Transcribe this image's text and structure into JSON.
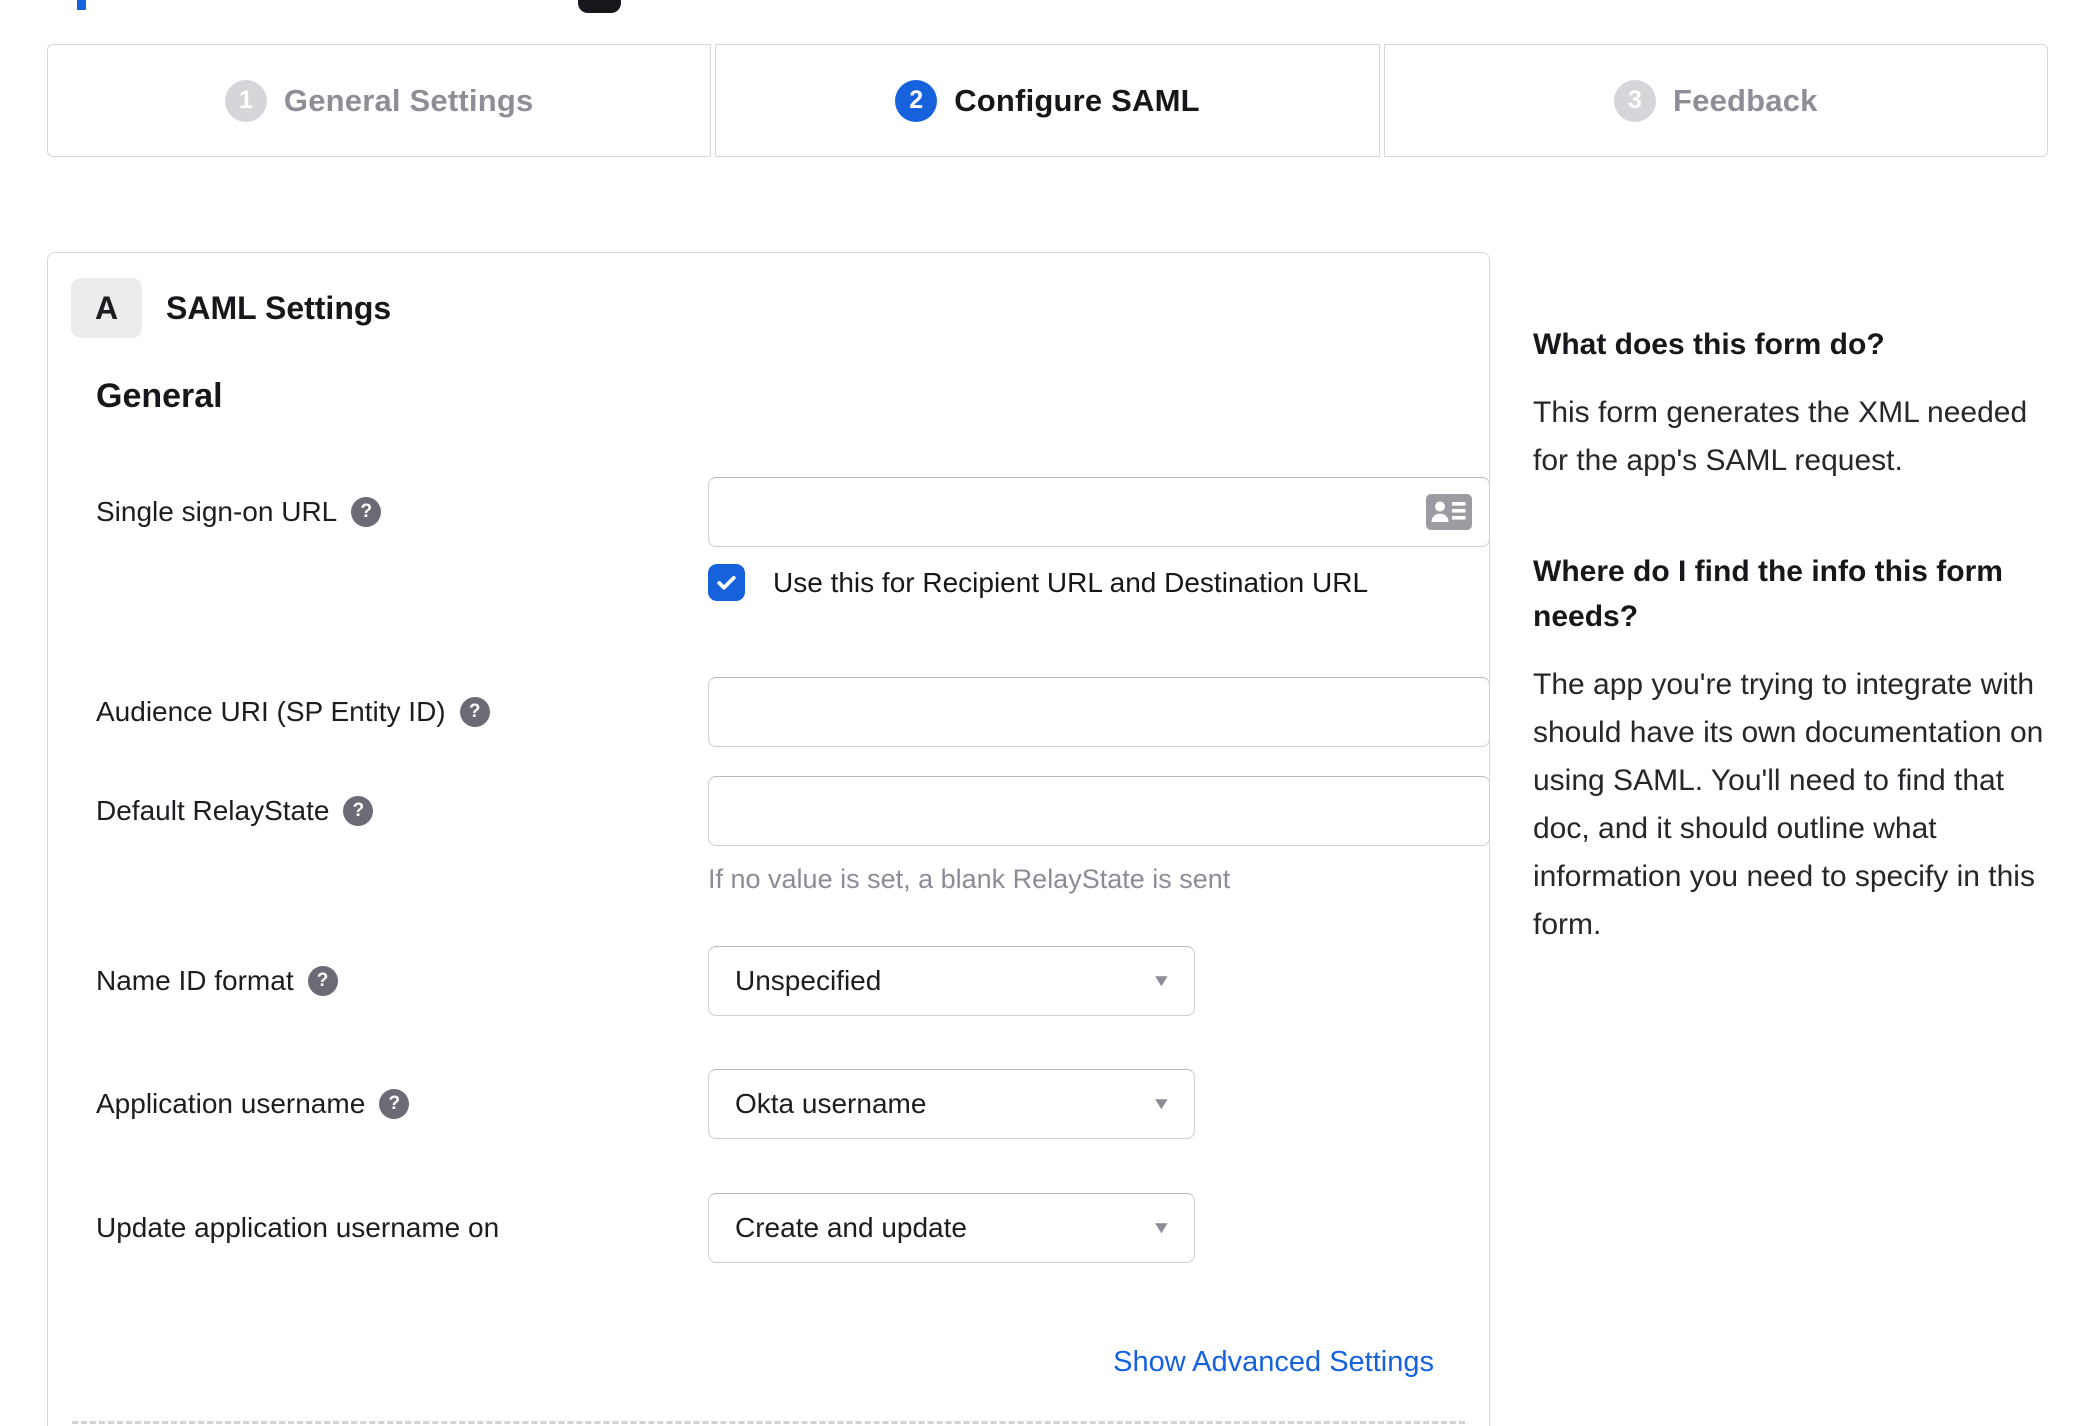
{
  "stepper": {
    "steps": [
      {
        "number": "1",
        "label": "General Settings",
        "state": "inactive"
      },
      {
        "number": "2",
        "label": "Configure SAML",
        "state": "active"
      },
      {
        "number": "3",
        "label": "Feedback",
        "state": "inactive"
      }
    ]
  },
  "panel": {
    "section_badge": "A",
    "section_title": "SAML Settings",
    "group_title": "General",
    "fields": {
      "sso_url": {
        "label": "Single sign-on URL",
        "value": "",
        "checkbox_label": "Use this for Recipient URL and Destination URL",
        "checkbox_checked": true
      },
      "audience_uri": {
        "label": "Audience URI (SP Entity ID)",
        "value": ""
      },
      "relay_state": {
        "label": "Default RelayState",
        "value": "",
        "hint": "If no value is set, a blank RelayState is sent"
      },
      "name_id_format": {
        "label": "Name ID format",
        "value": "Unspecified"
      },
      "app_username": {
        "label": "Application username",
        "value": "Okta username"
      },
      "update_app_username": {
        "label": "Update application username on",
        "value": "Create and update"
      }
    },
    "advanced_link": "Show Advanced Settings"
  },
  "sidebar": {
    "sections": [
      {
        "heading": "What does this form do?",
        "body": "This form generates the XML needed for the app's SAML request."
      },
      {
        "heading": "Where do I find the info this form needs?",
        "body": "The app you're trying to integrate with should have its own documentation on using SAML. You'll need to find that doc, and it should outline what information you need to specify in this form."
      }
    ]
  },
  "icons": {
    "help": "?",
    "caret": "▼"
  },
  "colors": {
    "accent_blue": "#1662dd",
    "link_blue": "#1662dd",
    "inactive_gray": "#d6d6da",
    "border_gray": "#d8d8dc",
    "hint_gray": "#8c8c96",
    "text_dark": "#1d1d21"
  }
}
